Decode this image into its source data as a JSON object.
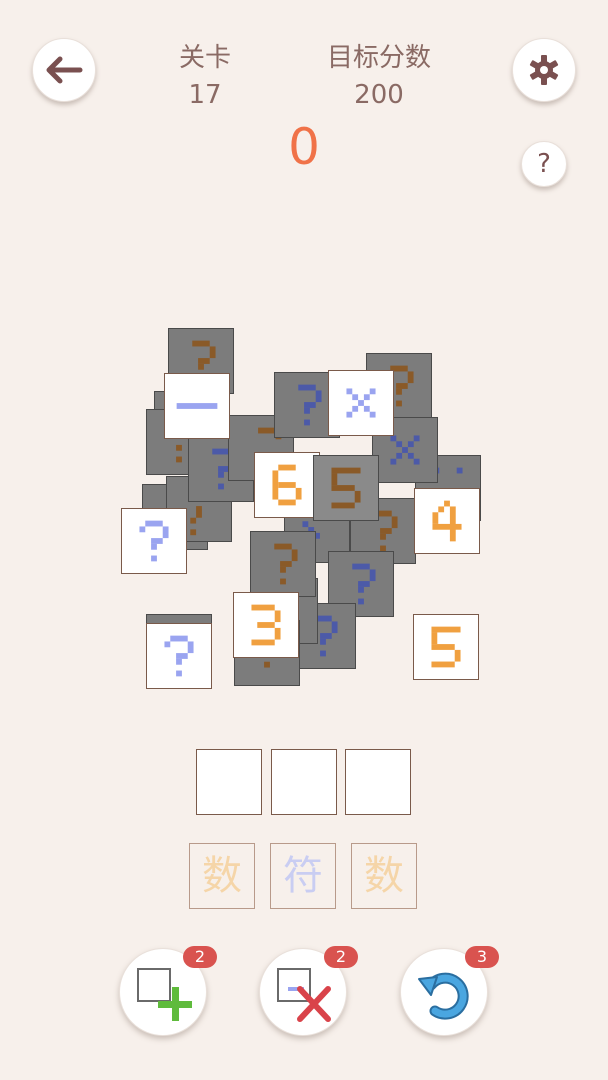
{
  "header": {
    "level_label": "关卡",
    "level_value": "17",
    "target_label": "目标分数",
    "target_value": "200",
    "score": "0"
  },
  "icons": {
    "back": "arrow-left-icon",
    "settings": "gear-icon",
    "help": "question-icon"
  },
  "help_label": "?",
  "colors": {
    "background": "#f7f0eb",
    "score": "#f07248",
    "number_tile": "#f0a040",
    "operator_tile": "#9aa4f0",
    "hidden_tile": "#7c7c7c",
    "badge": "#d9534f"
  },
  "board": {
    "face_up_tiles": [
      {
        "symbol": "−",
        "kind": "operator"
      },
      {
        "symbol": "×",
        "kind": "operator"
      },
      {
        "symbol": "6",
        "kind": "number"
      },
      {
        "symbol": "5",
        "kind": "number"
      },
      {
        "symbol": "4",
        "kind": "number"
      },
      {
        "symbol": "?",
        "kind": "wildcard"
      },
      {
        "symbol": "3",
        "kind": "number"
      },
      {
        "symbol": "?",
        "kind": "wildcard"
      },
      {
        "symbol": "5",
        "kind": "number"
      }
    ]
  },
  "slot_hints": [
    "数",
    "符",
    "数"
  ],
  "powerups": [
    {
      "name": "add-tile",
      "count": "2"
    },
    {
      "name": "remove-operator",
      "count": "2"
    },
    {
      "name": "undo",
      "count": "3"
    }
  ]
}
